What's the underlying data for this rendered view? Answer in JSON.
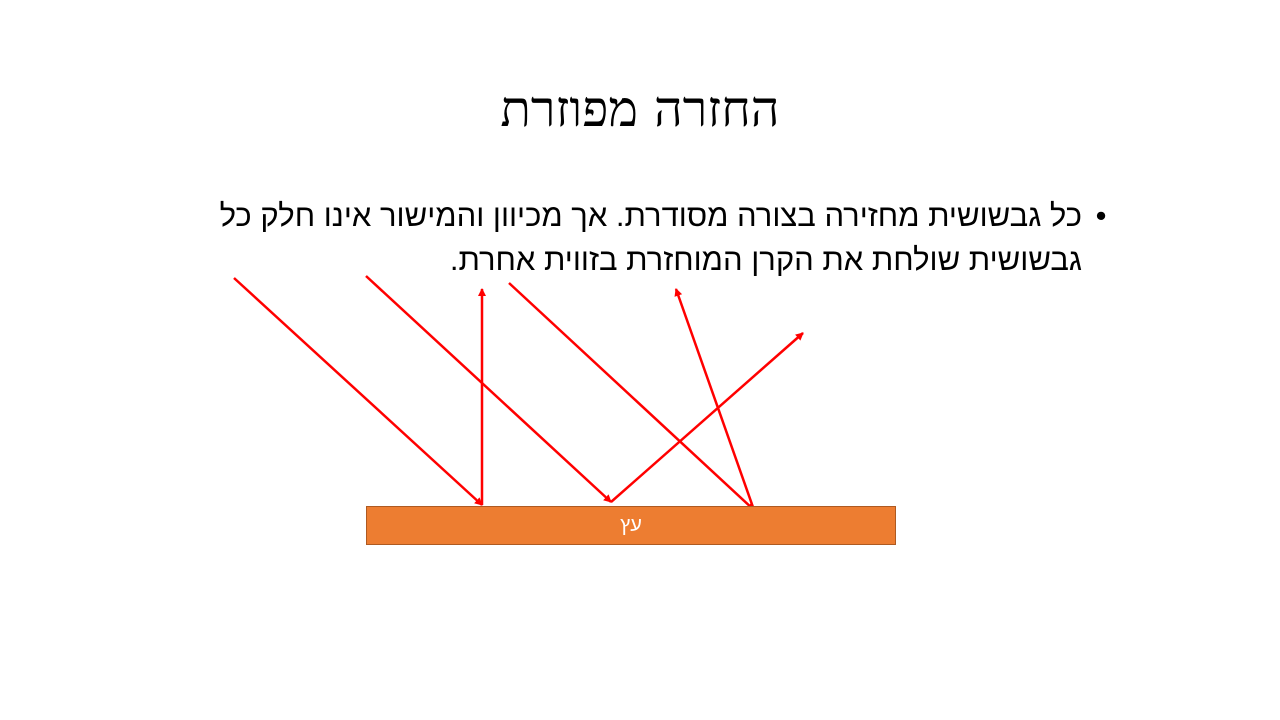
{
  "slide": {
    "title": "החזרה מפוזרת",
    "bullet_text": "כל גבשושית מחזירה בצורה מסודרת. אך מכיוון והמישור אינו חלק כל גבשושית שולחת את הקרן המוחזרת בזווית אחרת.",
    "bullet_symbol": "•"
  },
  "diagram": {
    "surface_label": "עץ",
    "surface_color": "#ED7D31",
    "ray_color": "#FF0000"
  }
}
